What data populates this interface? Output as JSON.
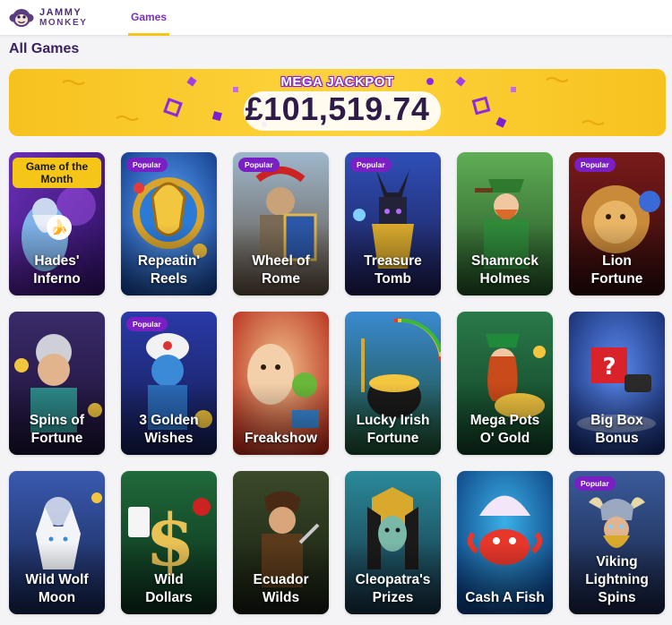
{
  "header": {
    "logo_line1": "JAMMY",
    "logo_line2": "MONKEY",
    "nav_games": "Games"
  },
  "page_title": "All Games",
  "jackpot": {
    "label": "MEGA JACKPOT",
    "amount": "£101,519.74"
  },
  "colors": {
    "brand_purple": "#7a1fc4",
    "accent_yellow": "#f5c518",
    "title_dark": "#3b2160"
  },
  "badges": {
    "popular": "Popular",
    "game_of_month": "Game of the Month"
  },
  "games": [
    {
      "name": "Hades' Inferno",
      "line1": "Hades'",
      "line2": "Inferno",
      "badge": "Game of the Month"
    },
    {
      "name": "Repeatin' Reels",
      "line1": "Repeatin'",
      "line2": "Reels",
      "badge": "Popular"
    },
    {
      "name": "Wheel of Rome",
      "line1": "Wheel of",
      "line2": "Rome",
      "badge": "Popular"
    },
    {
      "name": "Treasure Tomb",
      "line1": "Treasure",
      "line2": "Tomb",
      "badge": "Popular"
    },
    {
      "name": "Shamrock Holmes",
      "line1": "Shamrock",
      "line2": "Holmes",
      "badge": ""
    },
    {
      "name": "Lion Fortune",
      "line1": "Lion",
      "line2": "Fortune",
      "badge": "Popular"
    },
    {
      "name": "Spins of Fortune",
      "line1": "Spins of",
      "line2": "Fortune",
      "badge": ""
    },
    {
      "name": "3 Golden Wishes",
      "line1": "3 Golden",
      "line2": "Wishes",
      "badge": "Popular"
    },
    {
      "name": "Freakshow",
      "line1": "",
      "line2": "Freakshow",
      "badge": ""
    },
    {
      "name": "Lucky Irish Fortune",
      "line1": "Lucky Irish",
      "line2": "Fortune",
      "badge": ""
    },
    {
      "name": "Mega Pots O' Gold",
      "line1": "Mega Pots",
      "line2": "O' Gold",
      "badge": ""
    },
    {
      "name": "Big Box Bonus",
      "line1": "Big Box",
      "line2": "Bonus",
      "badge": ""
    },
    {
      "name": "Wild Wolf Moon",
      "line1": "Wild Wolf",
      "line2": "Moon",
      "badge": ""
    },
    {
      "name": "Wild Dollars",
      "line1": "Wild",
      "line2": "Dollars",
      "badge": ""
    },
    {
      "name": "Ecuador Wilds",
      "line1": "Ecuador",
      "line2": "Wilds",
      "badge": ""
    },
    {
      "name": "Cleopatra's Prizes",
      "line1": "Cleopatra's",
      "line2": "Prizes",
      "badge": ""
    },
    {
      "name": "Cash A Fish",
      "line1": "",
      "line2": "Cash A Fish",
      "badge": ""
    },
    {
      "name": "Viking Lightning Spins",
      "line1": "Viking",
      "line1b": "Lightning",
      "line2": "Spins",
      "badge": "Popular"
    }
  ]
}
